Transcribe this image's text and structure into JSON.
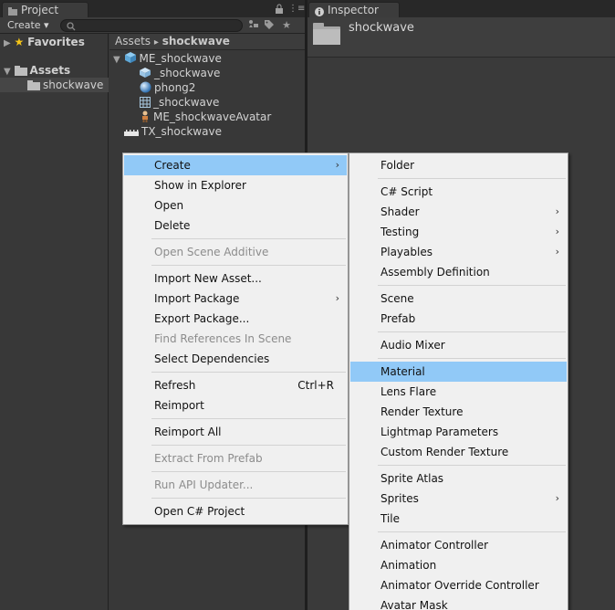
{
  "project_tab": {
    "label": "Project"
  },
  "inspector_tab": {
    "label": "Inspector"
  },
  "toolbar": {
    "create_label": "Create ▾",
    "search_placeholder": ""
  },
  "tree": {
    "favorites": "Favorites",
    "assets": "Assets",
    "folder": "shockwave"
  },
  "breadcrumb": {
    "root": "Assets",
    "separator": "▸",
    "current": "shockwave"
  },
  "assets": [
    {
      "name": "ME_shockwave",
      "icon": "model-prefab-icon"
    },
    {
      "name": "_shockwave",
      "icon": "mesh-icon"
    },
    {
      "name": "phong2",
      "icon": "material-sphere-icon"
    },
    {
      "name": "_shockwave",
      "icon": "grid-mesh-icon"
    },
    {
      "name": "ME_shockwaveAvatar",
      "icon": "avatar-icon"
    },
    {
      "name": "TX_shockwave",
      "icon": "texture-icon"
    }
  ],
  "inspector": {
    "title": "shockwave"
  },
  "context_menu": {
    "items": [
      {
        "label": "Create",
        "submenu": true,
        "highlighted": true
      },
      {
        "label": "Show in Explorer"
      },
      {
        "label": "Open"
      },
      {
        "label": "Delete"
      },
      {
        "label": "Open Scene Additive",
        "disabled": true
      },
      {
        "label": "Import New Asset..."
      },
      {
        "label": "Import Package",
        "submenu": true
      },
      {
        "label": "Export Package..."
      },
      {
        "label": "Find References In Scene",
        "disabled": true
      },
      {
        "label": "Select Dependencies"
      },
      {
        "label": "Refresh",
        "shortcut": "Ctrl+R"
      },
      {
        "label": "Reimport"
      },
      {
        "label": "Reimport All"
      },
      {
        "label": "Extract From Prefab",
        "disabled": true
      },
      {
        "label": "Run API Updater...",
        "disabled": true
      },
      {
        "label": "Open C# Project"
      }
    ]
  },
  "create_submenu": {
    "items": [
      {
        "label": "Folder"
      },
      {
        "label": "C# Script"
      },
      {
        "label": "Shader",
        "submenu": true
      },
      {
        "label": "Testing",
        "submenu": true
      },
      {
        "label": "Playables",
        "submenu": true
      },
      {
        "label": "Assembly Definition"
      },
      {
        "label": "Scene"
      },
      {
        "label": "Prefab"
      },
      {
        "label": "Audio Mixer"
      },
      {
        "label": "Material",
        "highlighted": true
      },
      {
        "label": "Lens Flare"
      },
      {
        "label": "Render Texture"
      },
      {
        "label": "Lightmap Parameters"
      },
      {
        "label": "Custom Render Texture"
      },
      {
        "label": "Sprite Atlas"
      },
      {
        "label": "Sprites",
        "submenu": true
      },
      {
        "label": "Tile"
      },
      {
        "label": "Animator Controller"
      },
      {
        "label": "Animation"
      },
      {
        "label": "Animator Override Controller"
      },
      {
        "label": "Avatar Mask"
      }
    ]
  },
  "colors": {
    "highlight": "#91c9f7",
    "menu_bg": "#f0f0f0",
    "editor_bg": "#383838"
  }
}
